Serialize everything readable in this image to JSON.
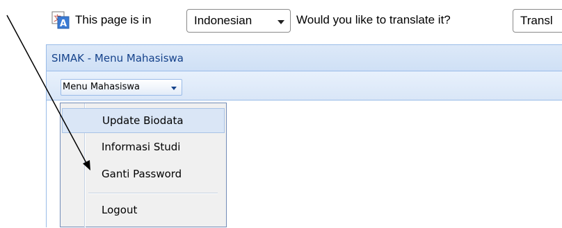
{
  "translate_bar": {
    "prefix": "This page is in",
    "language": "Indonesian",
    "question": "Would you like to translate it?",
    "translate_button": "Transl",
    "icon": "translate-icon"
  },
  "window": {
    "title": "SIMAK - Menu Mahasiswa",
    "menu_button": "Menu Mahasiswa"
  },
  "menu": {
    "items": [
      {
        "label": "Update Biodata",
        "active": true
      },
      {
        "label": "Informasi Studi"
      },
      {
        "label": "Ganti Password"
      },
      {
        "label": "Logout"
      }
    ]
  },
  "colors": {
    "accent": "#15428b",
    "panel_border": "#99bbe8",
    "highlight": "#dae6f6"
  }
}
